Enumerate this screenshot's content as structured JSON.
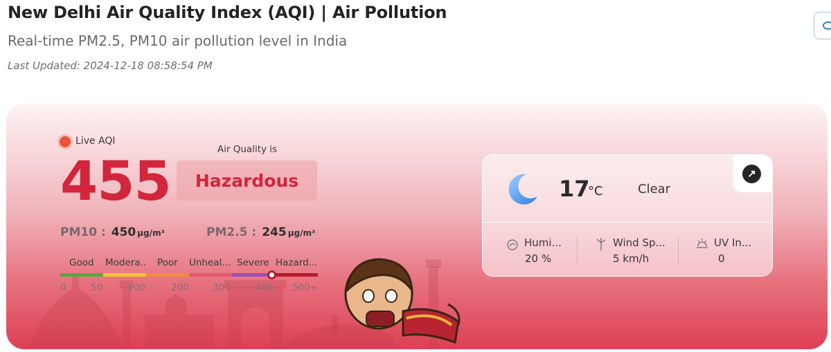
{
  "header": {
    "title": "New Delhi Air Quality Index (AQI) | Air Pollution",
    "subtitle": "Real-time PM2.5, PM10 air pollution level in India",
    "last_updated": "Last Updated: 2024-12-18 08:58:54 PM"
  },
  "aqi": {
    "live_label": "Live AQI",
    "value": "455",
    "air_quality_label": "Air Quality is",
    "status": "Hazardous",
    "pm10_label": "PM10 :",
    "pm10_value": "450",
    "pm10_unit": "µg/m³",
    "pm25_label": "PM2.5 :",
    "pm25_value": "245",
    "pm25_unit": "µg/m³",
    "scale": {
      "labels": [
        "Good",
        "Modera..",
        "Poor",
        "Unheal...",
        "Severe",
        "Hazard..."
      ],
      "numbers": [
        "0",
        "50",
        "100",
        "200",
        "300",
        "400",
        "500+"
      ],
      "colors": [
        "#5aa83c",
        "#f1c232",
        "#f28a3b",
        "#e65a6b",
        "#9b4fb1",
        "#b71c2f"
      ],
      "marker_value": 455
    }
  },
  "weather": {
    "temperature": "17",
    "unit": "°C",
    "condition": "Clear",
    "icon": "moon-icon",
    "metrics": [
      {
        "icon": "humidity-icon",
        "label": "Humi...",
        "value": "20 %"
      },
      {
        "icon": "wind-icon",
        "label": "Wind Sp...",
        "value": "5 km/h"
      },
      {
        "icon": "uv-icon",
        "label": "UV In...",
        "value": "0"
      }
    ]
  },
  "colors": {
    "aqi_accent": "#d1263c",
    "live_dot": "#e8553a"
  }
}
